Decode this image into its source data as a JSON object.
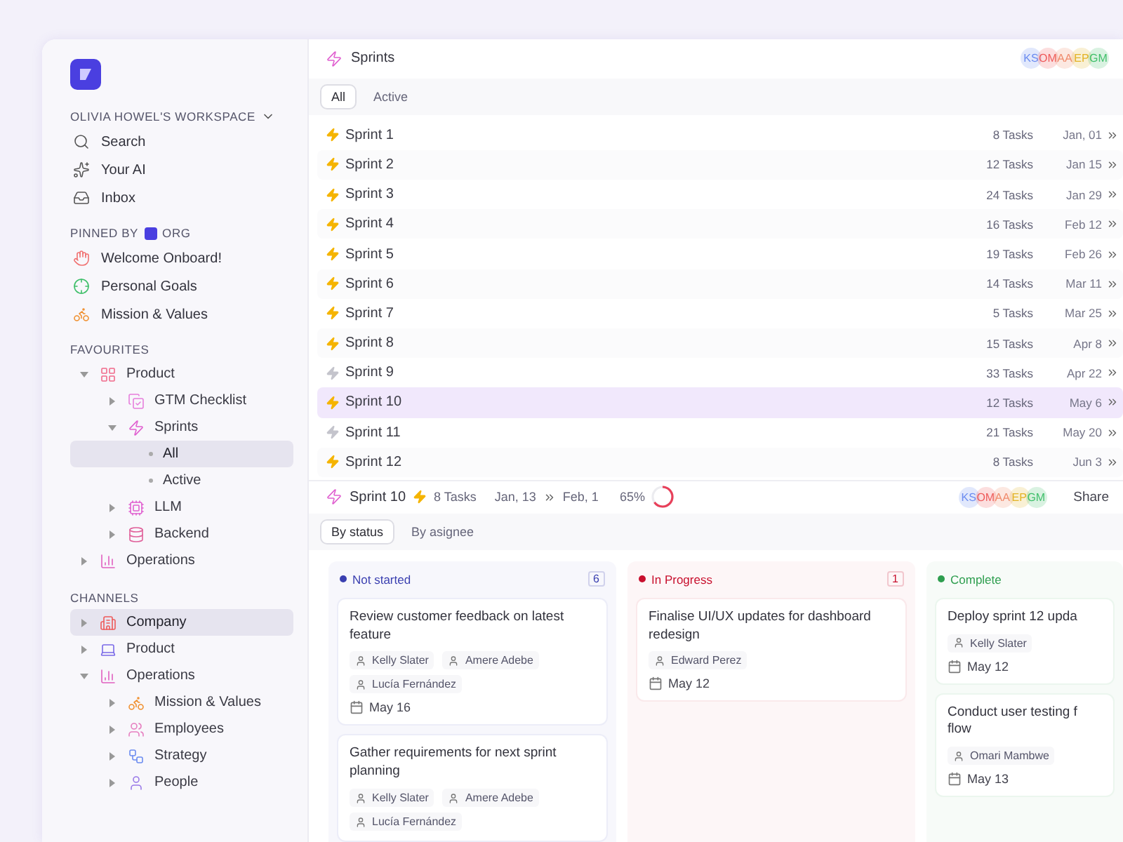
{
  "sidebar": {
    "workspace": "OLIVIA HOWEL'S WORKSPACE",
    "nav": [
      {
        "label": "Search",
        "kind": "search"
      },
      {
        "label": "Your AI",
        "kind": "ai"
      },
      {
        "label": "Inbox",
        "kind": "inbox"
      }
    ],
    "pinned_title": "PINNED BY",
    "pinned_org": "ORG",
    "pinned": [
      {
        "label": "Welcome Onboard!",
        "kind": "hand"
      },
      {
        "label": "Personal Goals",
        "kind": "target"
      },
      {
        "label": "Mission & Values",
        "kind": "scale"
      }
    ],
    "favourites_title": "FAVOURITES",
    "favourites": [
      {
        "label": "Product",
        "kind": "grid",
        "expanded": true,
        "selected": false,
        "children": [
          {
            "label": "GTM Checklist",
            "kind": "checklist",
            "expanded": false,
            "selected": false
          },
          {
            "label": "Sprints",
            "kind": "sprint",
            "expanded": true,
            "selected": false,
            "children": [
              {
                "label": "All",
                "kind": "view",
                "selected": true
              },
              {
                "label": "Active",
                "kind": "view",
                "selected": false
              }
            ]
          },
          {
            "label": "LLM",
            "kind": "chip",
            "expanded": false,
            "selected": false
          },
          {
            "label": "Backend",
            "kind": "database",
            "expanded": false,
            "selected": false
          }
        ]
      },
      {
        "label": "Operations",
        "kind": "chart",
        "expanded": false,
        "selected": false
      }
    ],
    "channels_title": "CHANNELS",
    "channels": [
      {
        "label": "Company",
        "kind": "building",
        "expanded": false,
        "selected": true
      },
      {
        "label": "Product",
        "kind": "laptop",
        "expanded": false,
        "selected": false
      },
      {
        "label": "Operations",
        "kind": "chart",
        "expanded": true,
        "selected": false,
        "children": [
          {
            "label": "Mission & Values",
            "kind": "scale",
            "expanded": false,
            "selected": false
          },
          {
            "label": "Employees",
            "kind": "users",
            "expanded": false,
            "selected": false
          },
          {
            "label": "Strategy",
            "kind": "route",
            "expanded": false,
            "selected": false
          },
          {
            "label": "People",
            "kind": "user",
            "expanded": false,
            "selected": false
          }
        ]
      }
    ]
  },
  "sprints": {
    "title": "Sprints",
    "members": [
      {
        "initials": "KS",
        "color": "#6b8cf0"
      },
      {
        "initials": "OM",
        "color": "#ef5b5b"
      },
      {
        "initials": "AA",
        "color": "#f08a6b"
      },
      {
        "initials": "EP",
        "color": "#e3b326"
      },
      {
        "initials": "GM",
        "color": "#3fbf6a"
      }
    ],
    "tabs": [
      {
        "label": "All",
        "selected": true
      },
      {
        "label": "Active",
        "selected": false
      }
    ],
    "rows": [
      {
        "name": "Sprint 1",
        "active": true,
        "selected": false,
        "tasks": "8 Tasks",
        "start": "Jan, 01"
      },
      {
        "name": "Sprint 2",
        "active": true,
        "selected": false,
        "tasks": "12 Tasks",
        "start": "Jan 15"
      },
      {
        "name": "Sprint 3",
        "active": true,
        "selected": false,
        "tasks": "24 Tasks",
        "start": "Jan 29"
      },
      {
        "name": "Sprint 4",
        "active": true,
        "selected": false,
        "tasks": "16 Tasks",
        "start": "Feb 12"
      },
      {
        "name": "Sprint 5",
        "active": true,
        "selected": false,
        "tasks": "19 Tasks",
        "start": "Feb 26"
      },
      {
        "name": "Sprint 6",
        "active": true,
        "selected": false,
        "tasks": "14 Tasks",
        "start": "Mar 11"
      },
      {
        "name": "Sprint 7",
        "active": true,
        "selected": false,
        "tasks": "5 Tasks",
        "start": "Mar 25"
      },
      {
        "name": "Sprint 8",
        "active": true,
        "selected": false,
        "tasks": "15 Tasks",
        "start": "Apr 8"
      },
      {
        "name": "Sprint 9",
        "active": false,
        "selected": false,
        "tasks": "33 Tasks",
        "start": "Apr 22"
      },
      {
        "name": "Sprint 10",
        "active": true,
        "selected": true,
        "tasks": "12 Tasks",
        "start": "May 6"
      },
      {
        "name": "Sprint 11",
        "active": false,
        "selected": false,
        "tasks": "21 Tasks",
        "start": "May 20"
      },
      {
        "name": "Sprint 12",
        "active": true,
        "selected": false,
        "tasks": "8 Tasks",
        "start": "Jun 3"
      }
    ]
  },
  "detail": {
    "title": "Sprint 10",
    "tasks": "8 Tasks",
    "start": "Jan, 13",
    "end": "Feb, 1",
    "percent": "65%",
    "level": 0.65,
    "members": [
      {
        "initials": "KS",
        "color": "#6b8cf0"
      },
      {
        "initials": "OM",
        "color": "#ef5b5b"
      },
      {
        "initials": "AA",
        "color": "#f08a6b"
      },
      {
        "initials": "EP",
        "color": "#e3b326"
      },
      {
        "initials": "GM",
        "color": "#3fbf6a"
      }
    ],
    "share": "Share",
    "tabs": [
      {
        "label": "By status",
        "selected": true
      },
      {
        "label": "By asignee",
        "selected": false
      }
    ],
    "columns": [
      {
        "label": "Not started",
        "color": "#3a3fb0",
        "count": "6",
        "cards": [
          {
            "title": "Review customer feedback on latest feature",
            "assignees": [
              "Kelly Slater",
              "Amere Adebe",
              "Lucía Fernández"
            ],
            "date": "May 16"
          },
          {
            "title": "Gather requirements for next sprint planning",
            "assignees": [
              "Kelly Slater",
              "Amere Adebe",
              "Lucía Fernández"
            ]
          }
        ]
      },
      {
        "label": "In Progress",
        "color": "#c8102e",
        "count": "1",
        "cards": [
          {
            "title": "Finalise UI/UX updates for dashboard redesign",
            "assignees": [
              "Edward Perez"
            ],
            "date": "May 12"
          }
        ]
      },
      {
        "label": "Complete",
        "color": "#2e9e4f",
        "cards": [
          {
            "title": "Deploy sprint 12 upda",
            "assignees": [
              "Kelly Slater"
            ],
            "date": "May 12"
          },
          {
            "title": "Conduct user testing f flow",
            "assignees": [
              "Omari Mambwe"
            ],
            "date": "May 13"
          }
        ]
      }
    ]
  }
}
